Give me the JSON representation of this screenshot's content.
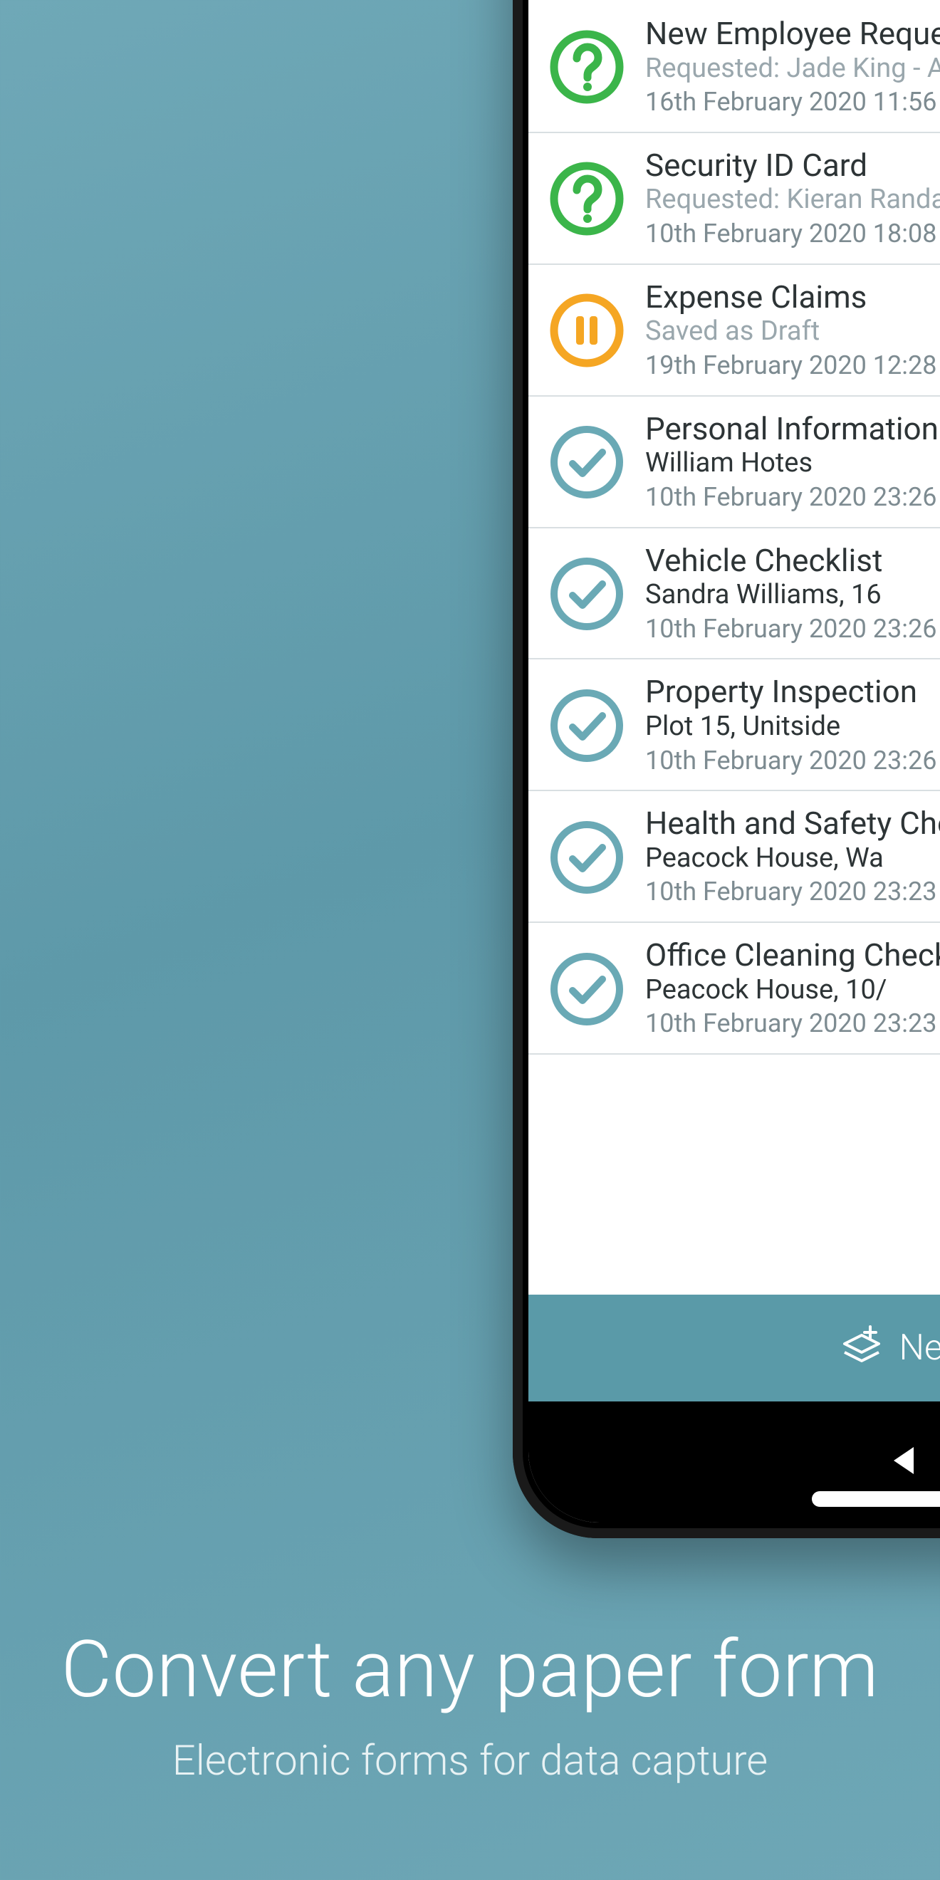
{
  "headline": {
    "title": "Convert any paper form",
    "subtitle": "Electronic forms for data capture"
  },
  "action_bar": {
    "label": "New"
  },
  "colors": {
    "accent": "#5a9aa8",
    "pending": "#3bb54a",
    "draft": "#f5a623",
    "done": "#6aa9b5"
  },
  "items": [
    {
      "status": "pending",
      "title": "New Employee Request",
      "subtitle": "Requested: Jade King - A",
      "subtitle_muted": true,
      "date": "16th February 2020 11:56"
    },
    {
      "status": "pending",
      "title": "Security ID Card",
      "subtitle": "Requested: Kieran Randall",
      "subtitle_muted": true,
      "date": "10th February 2020 18:08"
    },
    {
      "status": "draft",
      "title": "Expense Claims",
      "subtitle": "Saved as Draft",
      "subtitle_muted": true,
      "date": "19th February 2020 12:28"
    },
    {
      "status": "done",
      "title": "Personal Information",
      "subtitle": "William Hotes",
      "subtitle_muted": false,
      "date": "10th February 2020 23:26"
    },
    {
      "status": "done",
      "title": "Vehicle Checklist",
      "subtitle": "Sandra Williams, 16",
      "subtitle_muted": false,
      "date": "10th February 2020 23:26"
    },
    {
      "status": "done",
      "title": "Property Inspection",
      "subtitle": "Plot 15, Unitside",
      "subtitle_muted": false,
      "date": "10th February 2020 23:26"
    },
    {
      "status": "done",
      "title": "Health and Safety Checklist",
      "subtitle": "Peacock House, Wa",
      "subtitle_muted": false,
      "date": "10th February 2020 23:23"
    },
    {
      "status": "done",
      "title": "Office Cleaning Checklist",
      "subtitle": "Peacock House, 10/",
      "subtitle_muted": false,
      "date": "10th February 2020 23:23"
    }
  ]
}
